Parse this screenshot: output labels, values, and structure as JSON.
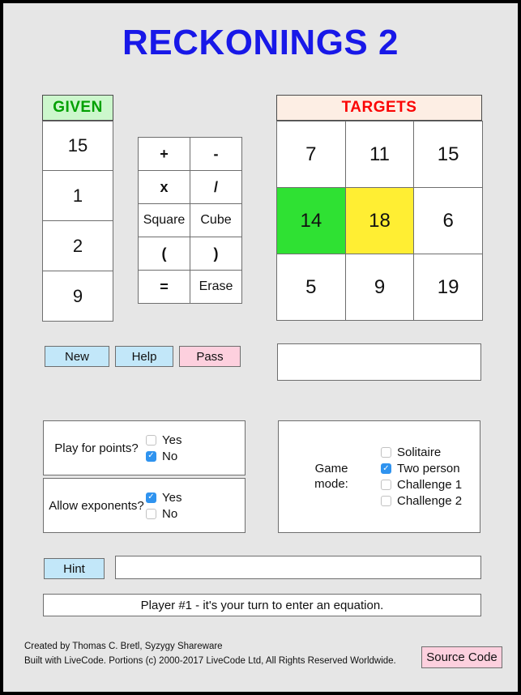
{
  "app": {
    "title": "RECKONINGS 2",
    "title_color": "#1818e8",
    "background_color": "#e6e6e6"
  },
  "given": {
    "header": "GIVEN",
    "header_bg": "#ccf7cc",
    "header_color": "#00a000",
    "values": [
      "15",
      "1",
      "2",
      "9"
    ]
  },
  "operators": {
    "buttons": [
      "+",
      "-",
      "x",
      "/",
      "Square",
      "Cube",
      "(",
      ")",
      "=",
      "Erase"
    ]
  },
  "targets": {
    "header": "TARGETS",
    "header_bg": "#fdeee4",
    "header_color": "#fb0505",
    "cells": [
      {
        "value": "7",
        "state": "normal"
      },
      {
        "value": "11",
        "state": "normal"
      },
      {
        "value": "15",
        "state": "normal"
      },
      {
        "value": "14",
        "state": "green"
      },
      {
        "value": "18",
        "state": "yellow"
      },
      {
        "value": "6",
        "state": "normal"
      },
      {
        "value": "5",
        "state": "normal"
      },
      {
        "value": "9",
        "state": "normal"
      },
      {
        "value": "19",
        "state": "normal"
      }
    ],
    "green_color": "#2fe133",
    "yellow_color": "#ffee33"
  },
  "actions": {
    "new": "New",
    "help": "Help",
    "pass": "Pass",
    "hint": "Hint",
    "source_code": "Source Code",
    "blue_color": "#c2e7f9",
    "pink_color": "#fdd0de"
  },
  "equation_display": {
    "value": ""
  },
  "hint_display": {
    "value": ""
  },
  "options": {
    "play_for_points": {
      "label": "Play for points?",
      "choices": [
        {
          "label": "Yes",
          "checked": false
        },
        {
          "label": "No",
          "checked": true
        }
      ]
    },
    "allow_exponents": {
      "label": "Allow exponents?",
      "choices": [
        {
          "label": "Yes",
          "checked": true
        },
        {
          "label": "No",
          "checked": false
        }
      ]
    },
    "game_mode": {
      "label_line1": "Game",
      "label_line2": "mode:",
      "choices": [
        {
          "label": "Solitaire",
          "checked": false
        },
        {
          "label": "Two person",
          "checked": true
        },
        {
          "label": "Challenge 1",
          "checked": false
        },
        {
          "label": "Challenge 2",
          "checked": false
        }
      ]
    }
  },
  "status": {
    "message": "Player #1 - it's your turn to enter an equation."
  },
  "footer": {
    "line1": "Created by Thomas C. Bretl, Syzygy Shareware",
    "line2": "Built with LiveCode. Portions (c) 2000-2017 LiveCode Ltd, All Rights Reserved Worldwide."
  }
}
